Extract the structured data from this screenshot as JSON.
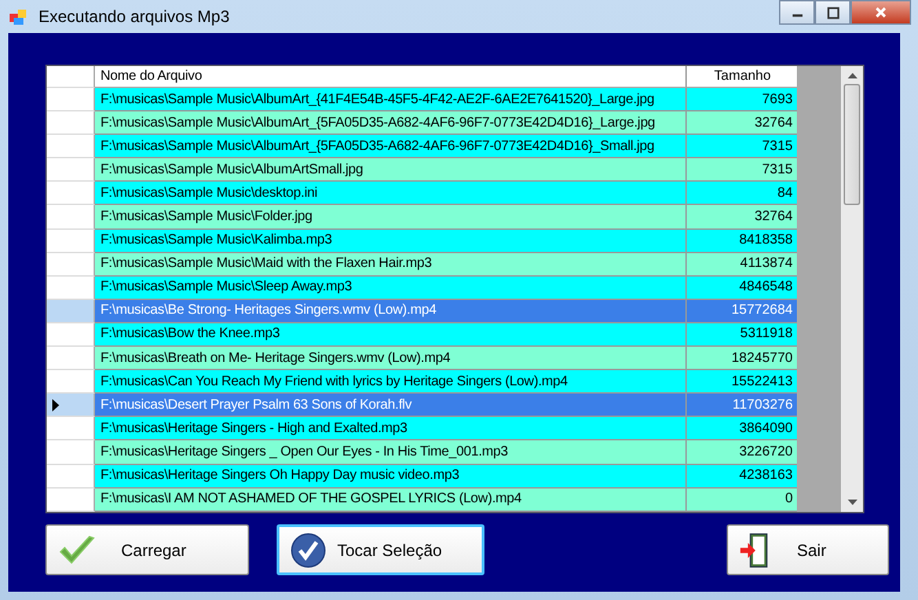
{
  "window": {
    "title": "Executando arquivos Mp3"
  },
  "table": {
    "columns": [
      "Nome do Arquivo",
      "Tamanho"
    ],
    "rows": [
      {
        "name": "F:\\musicas\\Sample Music\\AlbumArt_{41F4E54B-45F5-4F42-AE2F-6AE2E7641520}_Large.jpg",
        "size": "7693",
        "selected": false,
        "current": false
      },
      {
        "name": "F:\\musicas\\Sample Music\\AlbumArt_{5FA05D35-A682-4AF6-96F7-0773E42D4D16}_Large.jpg",
        "size": "32764",
        "selected": false,
        "current": false
      },
      {
        "name": "F:\\musicas\\Sample Music\\AlbumArt_{5FA05D35-A682-4AF6-96F7-0773E42D4D16}_Small.jpg",
        "size": "7315",
        "selected": false,
        "current": false
      },
      {
        "name": "F:\\musicas\\Sample Music\\AlbumArtSmall.jpg",
        "size": "7315",
        "selected": false,
        "current": false
      },
      {
        "name": "F:\\musicas\\Sample Music\\desktop.ini",
        "size": "84",
        "selected": false,
        "current": false
      },
      {
        "name": "F:\\musicas\\Sample Music\\Folder.jpg",
        "size": "32764",
        "selected": false,
        "current": false
      },
      {
        "name": "F:\\musicas\\Sample Music\\Kalimba.mp3",
        "size": "8418358",
        "selected": false,
        "current": false
      },
      {
        "name": "F:\\musicas\\Sample Music\\Maid with the Flaxen Hair.mp3",
        "size": "4113874",
        "selected": false,
        "current": false
      },
      {
        "name": "F:\\musicas\\Sample Music\\Sleep Away.mp3",
        "size": "4846548",
        "selected": false,
        "current": false
      },
      {
        "name": "F:\\musicas\\Be Strong- Heritages Singers.wmv (Low).mp4",
        "size": "15772684",
        "selected": true,
        "current": false
      },
      {
        "name": "F:\\musicas\\Bow the Knee.mp3",
        "size": "5311918",
        "selected": false,
        "current": false
      },
      {
        "name": "F:\\musicas\\Breath on Me- Heritage Singers.wmv (Low).mp4",
        "size": "18245770",
        "selected": false,
        "current": false
      },
      {
        "name": "F:\\musicas\\Can You Reach My Friend with lyrics by Heritage Singers (Low).mp4",
        "size": "15522413",
        "selected": false,
        "current": false
      },
      {
        "name": "F:\\musicas\\Desert Prayer Psalm 63 Sons of Korah.flv",
        "size": "11703276",
        "selected": true,
        "current": true
      },
      {
        "name": "F:\\musicas\\Heritage Singers - High and Exalted.mp3",
        "size": "3864090",
        "selected": false,
        "current": false
      },
      {
        "name": "F:\\musicas\\Heritage Singers _ Open Our Eyes - In His Time_001.mp3",
        "size": "3226720",
        "selected": false,
        "current": false
      },
      {
        "name": "F:\\musicas\\Heritage Singers Oh Happy Day music video.mp3",
        "size": "4238163",
        "selected": false,
        "current": false
      },
      {
        "name": "F:\\musicas\\I AM NOT ASHAMED OF THE GOSPEL LYRICS (Low).mp4",
        "size": "0",
        "selected": false,
        "current": false
      }
    ]
  },
  "buttons": [
    {
      "label": "Carregar",
      "kind": "check"
    },
    {
      "label": "Tocar Seleção",
      "kind": "round-check"
    },
    {
      "label": "Sair",
      "kind": "exit"
    }
  ]
}
